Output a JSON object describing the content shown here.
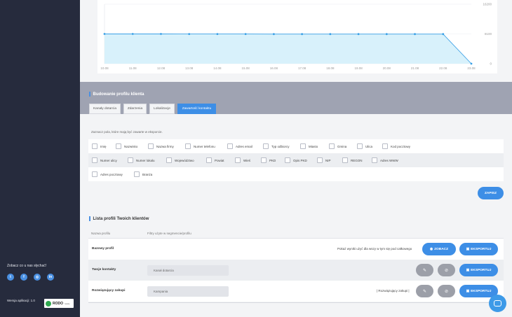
{
  "sidebar": {
    "follow_label": "Zobacz co u nas słychać!",
    "social": [
      {
        "icon": "twitter-icon",
        "glyph": "t"
      },
      {
        "icon": "facebook-icon",
        "glyph": "f"
      },
      {
        "icon": "instagram-icon",
        "glyph": "◎"
      },
      {
        "icon": "linkedin-icon",
        "glyph": "in"
      }
    ],
    "version_label": "Wersja aplikacji: 1.0",
    "badge_text": "RODO",
    "badge_sub": "ready"
  },
  "chart_data": {
    "type": "area",
    "x": [
      "10.08",
      "11.08",
      "12.08",
      "13.08",
      "14.08",
      "15.08",
      "16.08",
      "17.08",
      "18.08",
      "19.08",
      "20.08",
      "21.08",
      "22.08",
      "23.08"
    ],
    "values": [
      8100,
      8100,
      8100,
      8080,
      8080,
      8080,
      8060,
      8060,
      8060,
      8060,
      8060,
      8060,
      8060,
      0
    ],
    "yticks": [
      "16200",
      "8100",
      "0"
    ],
    "ylim": [
      0,
      16200
    ],
    "grid": true,
    "colors": {
      "line": "#3aa0e6",
      "fill": "#d8f1fb"
    }
  },
  "profile_builder": {
    "title": "Budowanie profilu klienta",
    "tabs": [
      {
        "label": "Kanały dotarcia",
        "active": false
      },
      {
        "label": "Zdarzenia",
        "active": false
      },
      {
        "label": "Lokalizacje",
        "active": false
      },
      {
        "label": "Zawartość kontaktu",
        "active": true
      }
    ],
    "note": "Zaznacz pola, które mają być zawarte w eksporcie.",
    "rows": [
      [
        "Imię",
        "Nazwisko",
        "Nazwa firmy",
        "Numer telefonu",
        "Adres email",
        "Typ odbiorcy",
        "Miasto",
        "Gmina",
        "Ulica",
        "Kod pocztowy"
      ],
      [
        "Numer ulicy",
        "Numer lokalu",
        "Województwo",
        "Powiat",
        "Wieś",
        "PKD",
        "Opis PKD",
        "NIP",
        "REGON",
        "Adres WWW"
      ],
      [
        "Adres pocztowy",
        "Branża"
      ]
    ],
    "save_label": "ZAPISZ"
  },
  "profile_list": {
    "title": "Lista profili Twoich klientów",
    "col_name": "Nazwa profilu",
    "col_filters": "Filtry użyte w segmencie/profilu",
    "rows": [
      {
        "name": "Bazowy profil",
        "filter": "",
        "note": "Pokaż wyniki użyć dla wszy w tym się pod całkowego",
        "view_label": "ZOBACZ",
        "export_label": "EKSPORTUJ"
      },
      {
        "name": "Twoje kontakty",
        "filter": "Kanał dotarcia",
        "note": "",
        "view_label": "",
        "export_label": "EKSPORTUJ"
      },
      {
        "name": "Rozwiązujący zakupi",
        "filter": "Kampania",
        "note": "| Rozwiązujący zakupi |",
        "view_label": "",
        "export_label": "EKSPORTUJ"
      }
    ]
  }
}
